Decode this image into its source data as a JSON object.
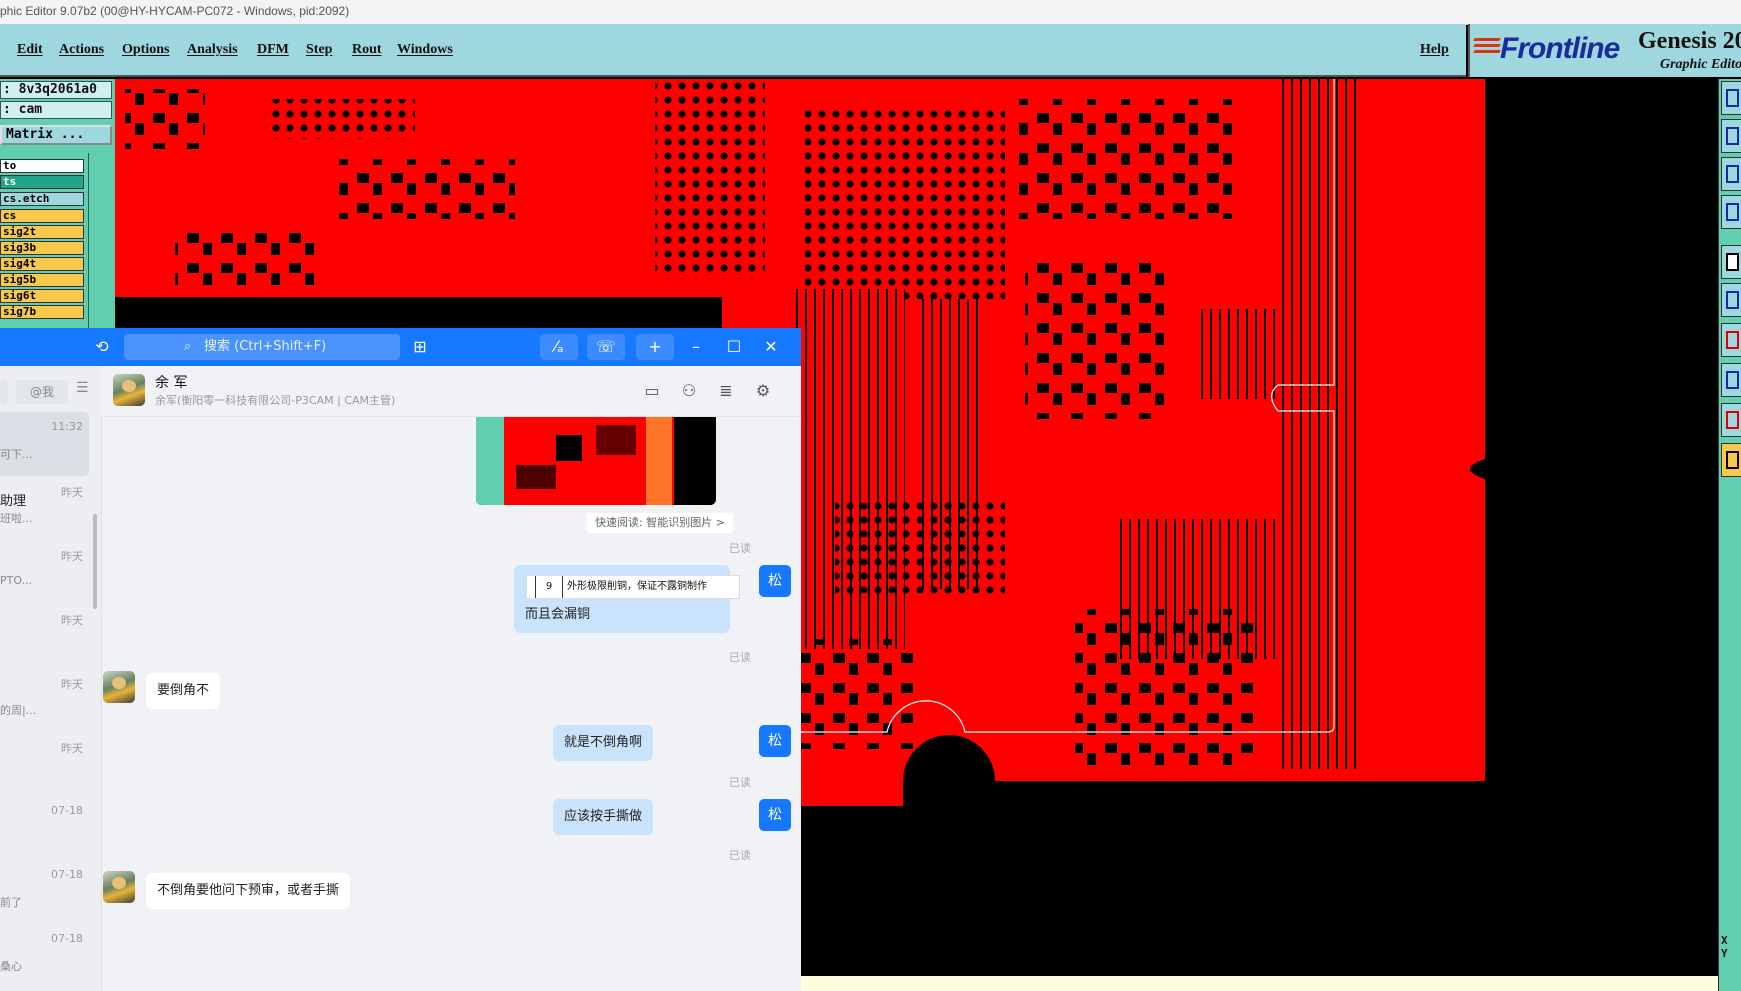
{
  "os_title": "phic Editor 9.07b2 (00@HY-HYCAM-PC072 - Windows, pid:2092)",
  "menu": [
    "Edit",
    "Actions",
    "Options",
    "Analysis",
    "DFM",
    "Step",
    "Rout",
    "Windows"
  ],
  "menu_help": "Help",
  "brand": {
    "logo": "Frontline",
    "product": "Genesis 20",
    "subtitle": "Graphic Edito"
  },
  "left_panel": {
    "job": ": 8v3q2061a0",
    "step": ": cam",
    "matrix_button": " Matrix ...",
    "layers": [
      {
        "name": "to",
        "style": "white"
      },
      {
        "name": "ts",
        "style": "green"
      },
      {
        "name": "cs.etch",
        "style": "cyan"
      },
      {
        "name": "cs",
        "style": "yellow"
      },
      {
        "name": "sig2t",
        "style": "yellow"
      },
      {
        "name": "sig3b",
        "style": "yellow"
      },
      {
        "name": "sig4t",
        "style": "yellow"
      },
      {
        "name": "sig5b",
        "style": "yellow"
      },
      {
        "name": "sig6t",
        "style": "yellow"
      },
      {
        "name": "sig7b",
        "style": "yellow"
      }
    ]
  },
  "right_toolbar_readout": "X\nY",
  "chat": {
    "search_placeholder": "搜索 (Ctrl+Shift+F)",
    "search_icon": "search-icon",
    "tabs": [
      "",
      "@我"
    ],
    "conversations": [
      {
        "time": "11:32",
        "name": "",
        "preview": "可下..."
      },
      {
        "time": "昨天",
        "name": "助理",
        "preview": "班啦..."
      },
      {
        "time": "昨天",
        "name": "",
        "preview": "PTO..."
      },
      {
        "time": "昨天",
        "name": "",
        "preview": ""
      },
      {
        "time": "昨天",
        "name": "",
        "preview": "的周|..."
      },
      {
        "time": "昨天",
        "name": "",
        "preview": ""
      },
      {
        "time": "07-18",
        "name": "",
        "preview": ""
      },
      {
        "time": "07-18",
        "name": "",
        "preview": "前了"
      },
      {
        "time": "07-18",
        "name": "",
        "preview": "桑心"
      }
    ],
    "contact": {
      "name": "余 军",
      "subtitle": "余军(衡阳零一科技有限公司-P3CAM | CAM主管)"
    },
    "quick_read": "快速阅读: 智能识别图片 >",
    "read_label": "已读",
    "me_avatar": "松",
    "quote": {
      "number": "9",
      "text": "外形极限削铜，保证不露铜制作"
    },
    "messages": [
      {
        "from": "me",
        "text": "而且会漏铜"
      },
      {
        "from": "other",
        "text": "要倒角不"
      },
      {
        "from": "me",
        "text": "就是不倒角啊"
      },
      {
        "from": "me",
        "text": "应该按手撕做"
      },
      {
        "from": "other",
        "text": "不倒角要他问下预审，或者手撕"
      }
    ]
  },
  "colors": {
    "menu_bg": "#9ed8de",
    "panel_bg": "#5fcfb0",
    "copper": "#ff0000",
    "chat_accent": "#1677ff",
    "my_bubble": "#c9e3fd"
  }
}
